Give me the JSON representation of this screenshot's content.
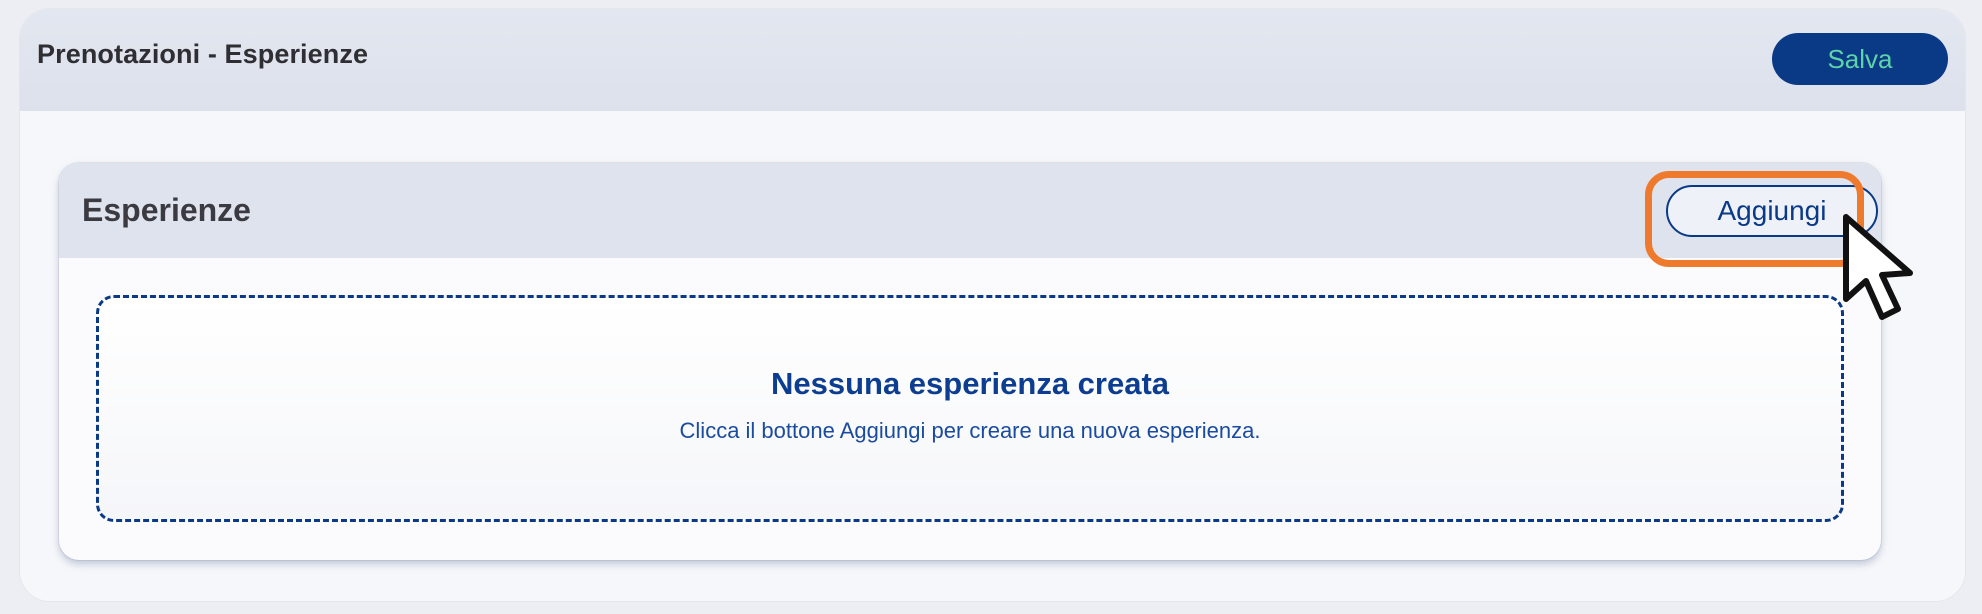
{
  "header": {
    "title": "Prenotazioni - Esperienze",
    "save_label": "Salva"
  },
  "section": {
    "title": "Esperienze",
    "add_label": "Aggiungi",
    "empty_title": "Nessuna esperienza creata",
    "empty_message": "Clicca il bottone Aggiungi per creare una nuova esperienza."
  },
  "colors": {
    "primary": "#0a3a86",
    "save_text": "#5dd4a8",
    "highlight": "#ee7a2e"
  },
  "icons": {
    "pointer": "mouse-pointer-icon"
  }
}
